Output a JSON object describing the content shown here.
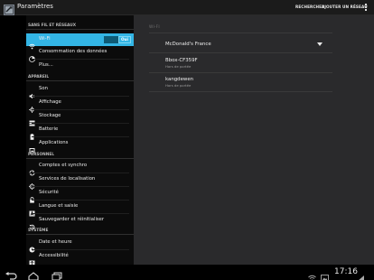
{
  "actionbar": {
    "title": "Paramètres",
    "actions": [
      "RECHERCHER",
      "AJOUTER UN RÉSEAU"
    ]
  },
  "sidebar": {
    "sections": [
      "SANS FIL ET RÉSEAUX",
      "APPAREIL",
      "PERSONNEL",
      "SYSTÈME"
    ],
    "wireless": [
      {
        "label": "Wi-Fi",
        "icon": "wifi-icon",
        "toggle": "Oui"
      },
      {
        "label": "Consommation des données",
        "icon": "data-usage-icon"
      },
      {
        "label": "Plus..."
      }
    ],
    "device": [
      {
        "label": "Son",
        "icon": "volume-icon"
      },
      {
        "label": "Affichage",
        "icon": "display-icon"
      },
      {
        "label": "Stockage",
        "icon": "storage-icon"
      },
      {
        "label": "Batterie",
        "icon": "battery-icon"
      },
      {
        "label": "Applications",
        "icon": "apps-icon"
      }
    ],
    "personal": [
      {
        "label": "Comptes et synchro",
        "icon": "sync-icon"
      },
      {
        "label": "Services de localisation",
        "icon": "location-icon"
      },
      {
        "label": "Sécurité",
        "icon": "lock-icon"
      },
      {
        "label": "Langue et saisie",
        "icon": "language-icon"
      },
      {
        "label": "Sauvegarder et réinitialiser",
        "icon": "backup-icon"
      }
    ],
    "system": [
      {
        "label": "Date et heure",
        "icon": "clock-icon"
      },
      {
        "label": "Accessibilité",
        "icon": "accessibility-icon"
      }
    ]
  },
  "main": {
    "header": "WI-FI",
    "networks": [
      {
        "ssid": "McDonald's France",
        "status": ""
      },
      {
        "ssid": "Bbox-CF359F",
        "status": "Hors de portée"
      },
      {
        "ssid": "kangdewen",
        "status": "Hors de portée"
      }
    ]
  },
  "statusbar": {
    "time": "17:16"
  },
  "colors": {
    "accent": "#33b5e5",
    "panel": "#2a2a2c",
    "sidebar": "#0b0b0b"
  }
}
